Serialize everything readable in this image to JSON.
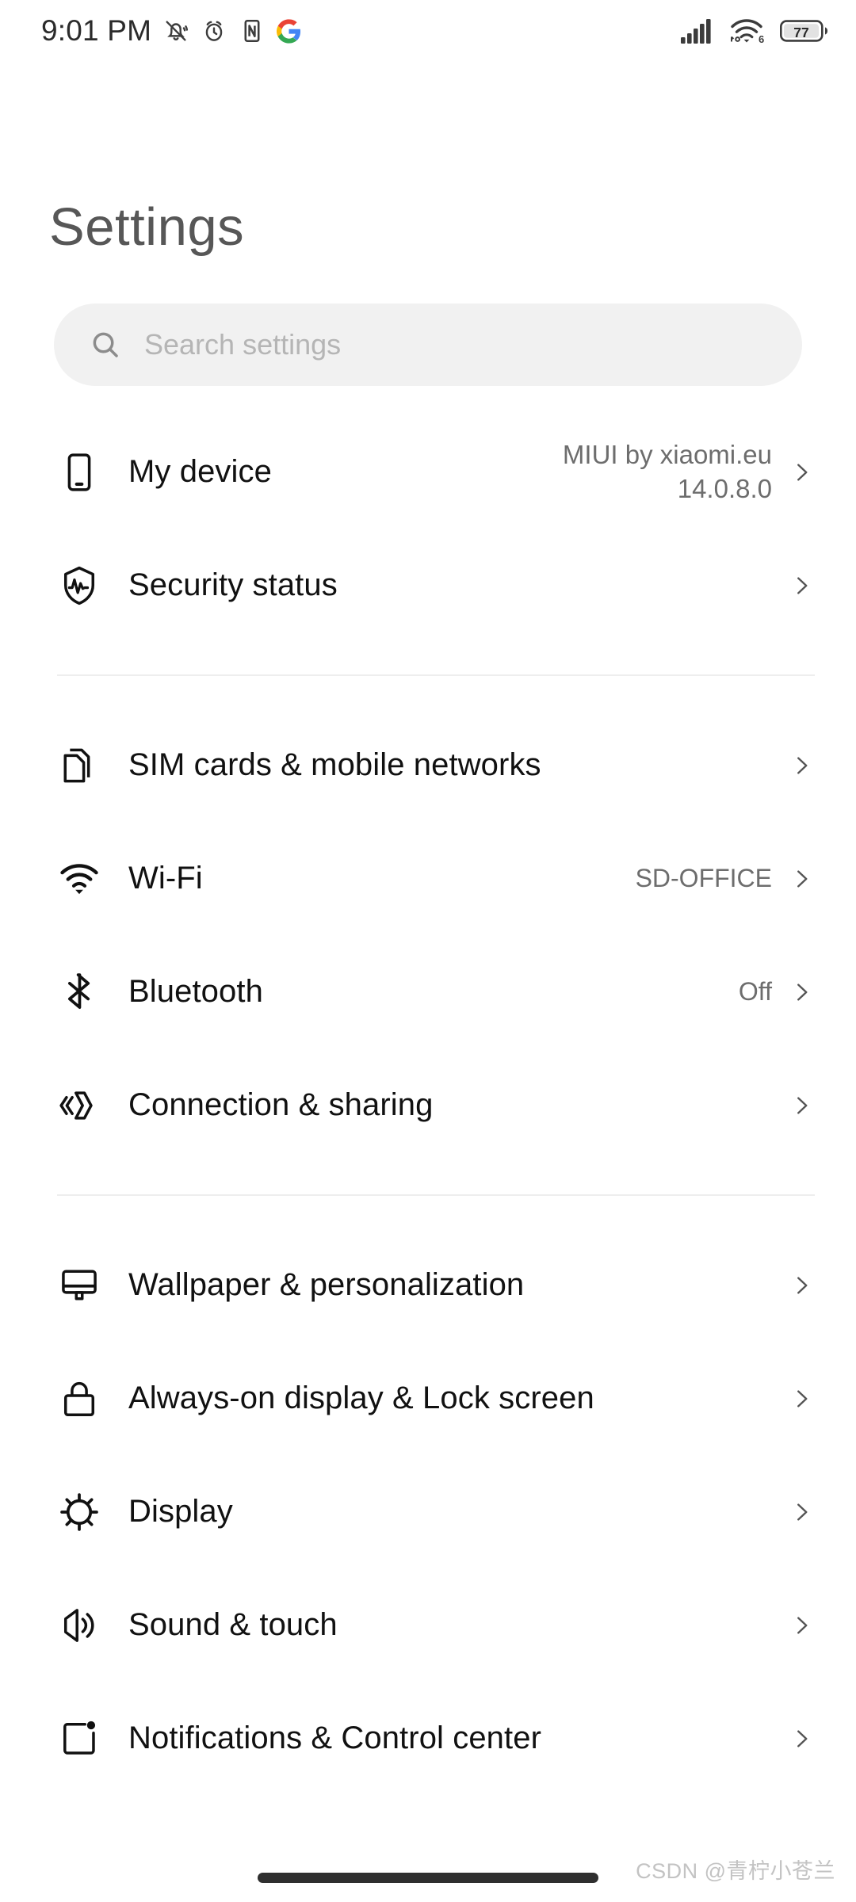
{
  "status_bar": {
    "time": "9:01 PM",
    "left_icons": [
      "bell-muted-icon",
      "alarm-clock-icon",
      "nfc-icon",
      "google-g-icon"
    ],
    "right_icons": [
      "cellular-signal-icon",
      "wifi-6-icon",
      "battery-icon"
    ],
    "battery_level": "77",
    "wifi_generation": "6"
  },
  "header": {
    "title": "Settings"
  },
  "search": {
    "placeholder": "Search settings",
    "icon": "search-icon"
  },
  "groups": [
    {
      "items": [
        {
          "icon": "phone-device-icon",
          "label": "My device",
          "value": "MIUI by xiaomi.eu\n14.0.8.0",
          "chevron": "chevron-right-icon"
        },
        {
          "icon": "shield-pulse-icon",
          "label": "Security status",
          "value": "",
          "chevron": "chevron-right-icon"
        }
      ]
    },
    {
      "items": [
        {
          "icon": "sim-cards-icon",
          "label": "SIM cards & mobile networks",
          "value": "",
          "chevron": "chevron-right-icon"
        },
        {
          "icon": "wifi-icon",
          "label": "Wi-Fi",
          "value": "SD-OFFICE",
          "chevron": "chevron-right-icon"
        },
        {
          "icon": "bluetooth-icon",
          "label": "Bluetooth",
          "value": "Off",
          "chevron": "chevron-right-icon"
        },
        {
          "icon": "connection-share-icon",
          "label": "Connection & sharing",
          "value": "",
          "chevron": "chevron-right-icon"
        }
      ]
    },
    {
      "items": [
        {
          "icon": "wallpaper-icon",
          "label": "Wallpaper & personalization",
          "value": "",
          "chevron": "chevron-right-icon"
        },
        {
          "icon": "lock-icon",
          "label": "Always-on display & Lock screen",
          "value": "",
          "chevron": "chevron-right-icon"
        },
        {
          "icon": "brightness-icon",
          "label": "Display",
          "value": "",
          "chevron": "chevron-right-icon"
        },
        {
          "icon": "speaker-icon",
          "label": "Sound & touch",
          "value": "",
          "chevron": "chevron-right-icon"
        },
        {
          "icon": "notification-icon",
          "label": "Notifications & Control center",
          "value": "",
          "chevron": "chevron-right-icon"
        }
      ]
    }
  ],
  "watermark": "CSDN @青柠小苍兰",
  "colors": {
    "background": "#ffffff",
    "title": "#575757",
    "label": "#111111",
    "value": "#6d6d6d",
    "search_bg": "#f1f1f1",
    "placeholder": "#b5b5b5",
    "divider": "#eeeeee",
    "gesture_bar": "#2f2f2f"
  }
}
